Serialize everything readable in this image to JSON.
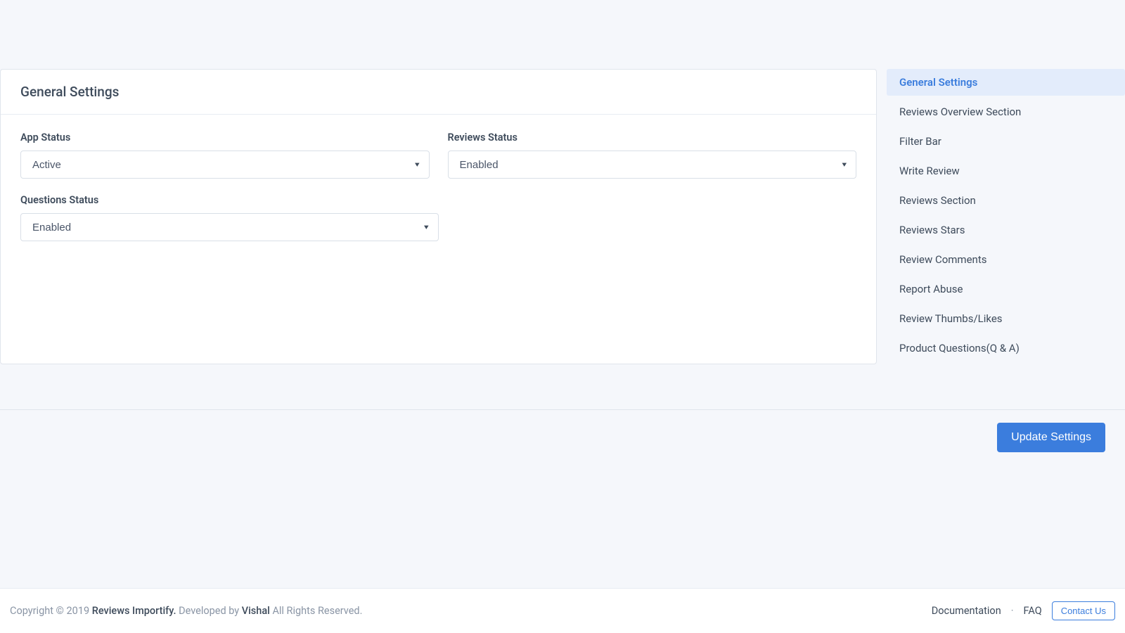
{
  "card": {
    "title": "General Settings",
    "fields": {
      "app_status": {
        "label": "App Status",
        "value": "Active"
      },
      "reviews_status": {
        "label": "Reviews Status",
        "value": "Enabled"
      },
      "questions_status": {
        "label": "Questions Status",
        "value": "Enabled"
      }
    }
  },
  "sidebar": {
    "items": [
      "General Settings",
      "Reviews Overview Section",
      "Filter Bar",
      "Write Review",
      "Reviews Section",
      "Reviews Stars",
      "Review Comments",
      "Report Abuse",
      "Review Thumbs/Likes",
      "Product Questions(Q & A)"
    ]
  },
  "actions": {
    "update_label": "Update Settings"
  },
  "footer": {
    "copyright_prefix": "Copyright © 2019 ",
    "app_name": "Reviews Importify.",
    "developed_by_prefix": " Developed by ",
    "developer": "Vishal",
    "rights": " All Rights Reserved.",
    "links": {
      "documentation": "Documentation",
      "faq": "FAQ",
      "contact": "Contact Us"
    }
  }
}
